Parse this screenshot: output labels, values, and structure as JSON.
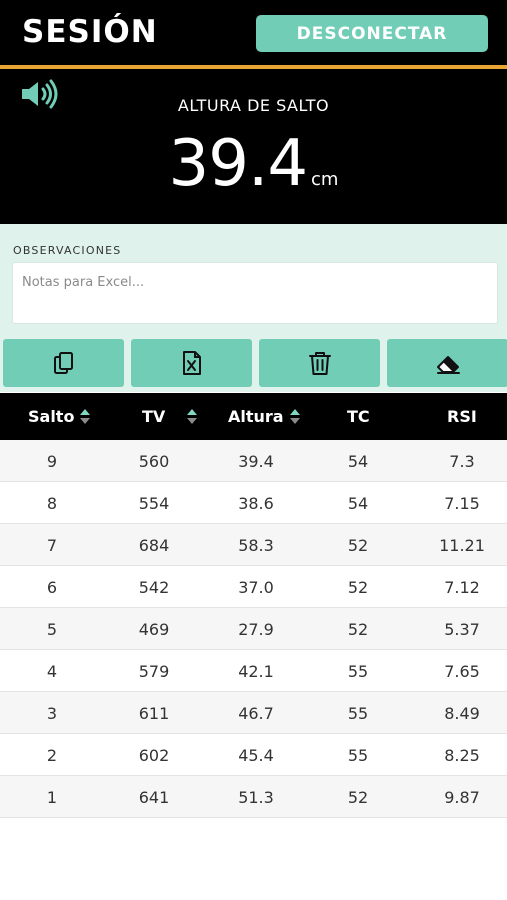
{
  "header": {
    "title": "SESIÓN",
    "disconnect_label": "DESCONECTAR"
  },
  "display": {
    "sound_icon": "speaker-volume-icon",
    "metric_label": "ALTURA DE SALTO",
    "metric_value": "39.4",
    "metric_unit": "cm"
  },
  "observations": {
    "label": "OBSERVACIONES",
    "placeholder": "Notas para Excel...",
    "value": ""
  },
  "actions": [
    {
      "icon": "copy-icon"
    },
    {
      "icon": "excel-file-icon"
    },
    {
      "icon": "trash-icon"
    },
    {
      "icon": "eraser-icon"
    }
  ],
  "table": {
    "headers": [
      "Salto",
      "TV",
      "Altura",
      "TC",
      "RSI"
    ],
    "rows": [
      [
        "9",
        "560",
        "39.4",
        "54",
        "7.3"
      ],
      [
        "8",
        "554",
        "38.6",
        "54",
        "7.15"
      ],
      [
        "7",
        "684",
        "58.3",
        "52",
        "11.21"
      ],
      [
        "6",
        "542",
        "37.0",
        "52",
        "7.12"
      ],
      [
        "5",
        "469",
        "27.9",
        "52",
        "5.37"
      ],
      [
        "4",
        "579",
        "42.1",
        "55",
        "7.65"
      ],
      [
        "3",
        "611",
        "46.7",
        "55",
        "8.49"
      ],
      [
        "2",
        "602",
        "45.4",
        "55",
        "8.25"
      ],
      [
        "1",
        "641",
        "51.3",
        "52",
        "9.87"
      ]
    ]
  },
  "colors": {
    "accent": "#72cdb6",
    "panel_bg": "#dff3ec",
    "header_bg": "#000000",
    "divider": "#e9a533"
  }
}
